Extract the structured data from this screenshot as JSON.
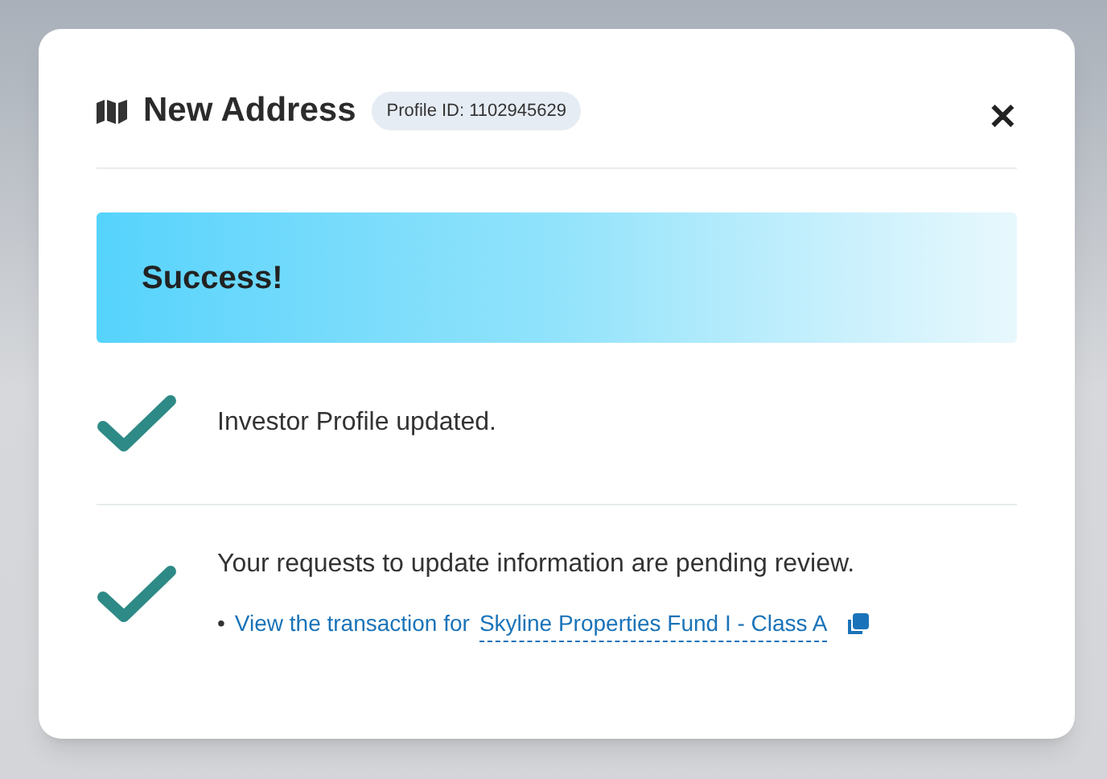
{
  "dialog": {
    "title": "New Address",
    "profile_badge": "Profile ID: 1102945629",
    "close": "✕"
  },
  "banner": {
    "text": "Success!"
  },
  "items": [
    {
      "text": "Investor Profile updated."
    },
    {
      "text": "Your requests to update information are pending review.",
      "link": {
        "bullet": "•",
        "prefix": "View the transaction for",
        "label": "Skyline Properties Fund I - Class A"
      }
    }
  ]
}
